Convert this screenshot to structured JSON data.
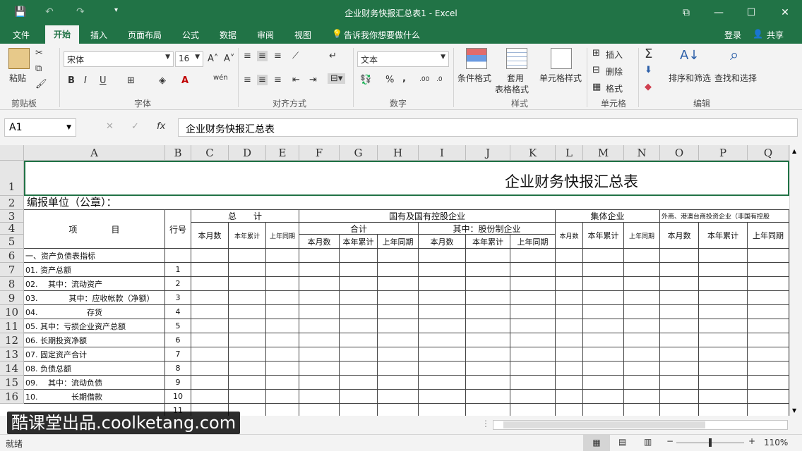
{
  "window": {
    "title": "企业财务快报汇总表1 - Excel",
    "qa": {
      "save": "💾",
      "undo": "↶",
      "redo": "↷",
      "more": "▾"
    },
    "controls": {
      "ribbon_display": "⧉",
      "minimize": "—",
      "maximize": "☐",
      "close": "✕"
    }
  },
  "tabs": {
    "file": "文件",
    "home": "开始",
    "insert": "插入",
    "page_layout": "页面布局",
    "formulas": "公式",
    "data": "数据",
    "review": "审阅",
    "view": "视图",
    "tell": "告诉我你想要做什么",
    "login": "登录",
    "share": "共享"
  },
  "ribbon": {
    "clipboard": {
      "paste": "粘贴",
      "label": "剪贴板"
    },
    "font": {
      "name": "宋体",
      "size": "16",
      "label": "字体",
      "bold": "B",
      "italic": "I",
      "underline": "U",
      "grow": "A˄",
      "shrink": "A˅",
      "wen": "wén"
    },
    "alignment": {
      "label": "对齐方式"
    },
    "number": {
      "format": "文本",
      "label": "数字",
      "percent": "%",
      "comma": ","
    },
    "styles": {
      "conditional": "条件格式",
      "table_line1": "套用",
      "table_line2": "表格格式",
      "cell_styles": "单元格样式",
      "label": "样式"
    },
    "cells": {
      "insert": "插入",
      "delete": "删除",
      "format": "格式",
      "label": "单元格"
    },
    "editing": {
      "sort": "排序和筛选",
      "find": "查找和选择",
      "label": "编辑"
    }
  },
  "formula_bar": {
    "name_box": "A1",
    "fx": "fx",
    "cancel": "✕",
    "enter": "✓",
    "content": "企业财务快报汇总表"
  },
  "columns": [
    "A",
    "B",
    "C",
    "D",
    "E",
    "F",
    "G",
    "H",
    "I",
    "J",
    "K",
    "L",
    "M",
    "N",
    "O",
    "P",
    "Q"
  ],
  "rows": [
    "1",
    "2",
    "3",
    "4",
    "5",
    "6",
    "7",
    "8",
    "9",
    "10",
    "11",
    "12",
    "13",
    "14",
    "15",
    "16"
  ],
  "sheet": {
    "title": "企业财务快报汇总表",
    "unit": "编报单位（公章）：",
    "item_header": "项　　　　目",
    "line_header": "行号",
    "group_total": "总　　计",
    "group_state": "国有及国有控股企业",
    "group_collective": "集体企业",
    "group_foreign": "外商、港澳台商投资企业（非国有控股",
    "sub_sum": "合计",
    "sub_share": "其中：股份制企业",
    "h_month": "本月数",
    "h_cum": "本年累计",
    "h_last": "上年同期",
    "section": "一、资产负债表指标",
    "items": [
      {
        "label": "01. 资产总额",
        "no": "1"
      },
      {
        "label": "02.　 其中：流动资产",
        "no": "2"
      },
      {
        "label": "03.　　　　其中：应收帐款（净额）",
        "no": "3"
      },
      {
        "label": "04.　　　　　　 存货",
        "no": "4"
      },
      {
        "label": "05. 其中：亏损企业资产总额",
        "no": "5"
      },
      {
        "label": "06. 长期投资净额",
        "no": "6"
      },
      {
        "label": "07. 固定资产合计",
        "no": "7"
      },
      {
        "label": "08. 负债总额",
        "no": "8"
      },
      {
        "label": "09.　 其中：流动负债",
        "no": "9"
      },
      {
        "label": "10.　　　　 长期借款",
        "no": "10"
      },
      {
        "label": "",
        "no": "11"
      }
    ]
  },
  "status": {
    "ready": "就绪",
    "zoom": "110%",
    "minus": "−",
    "plus": "+"
  },
  "watermark": "酷课堂出品.coolketang.com"
}
